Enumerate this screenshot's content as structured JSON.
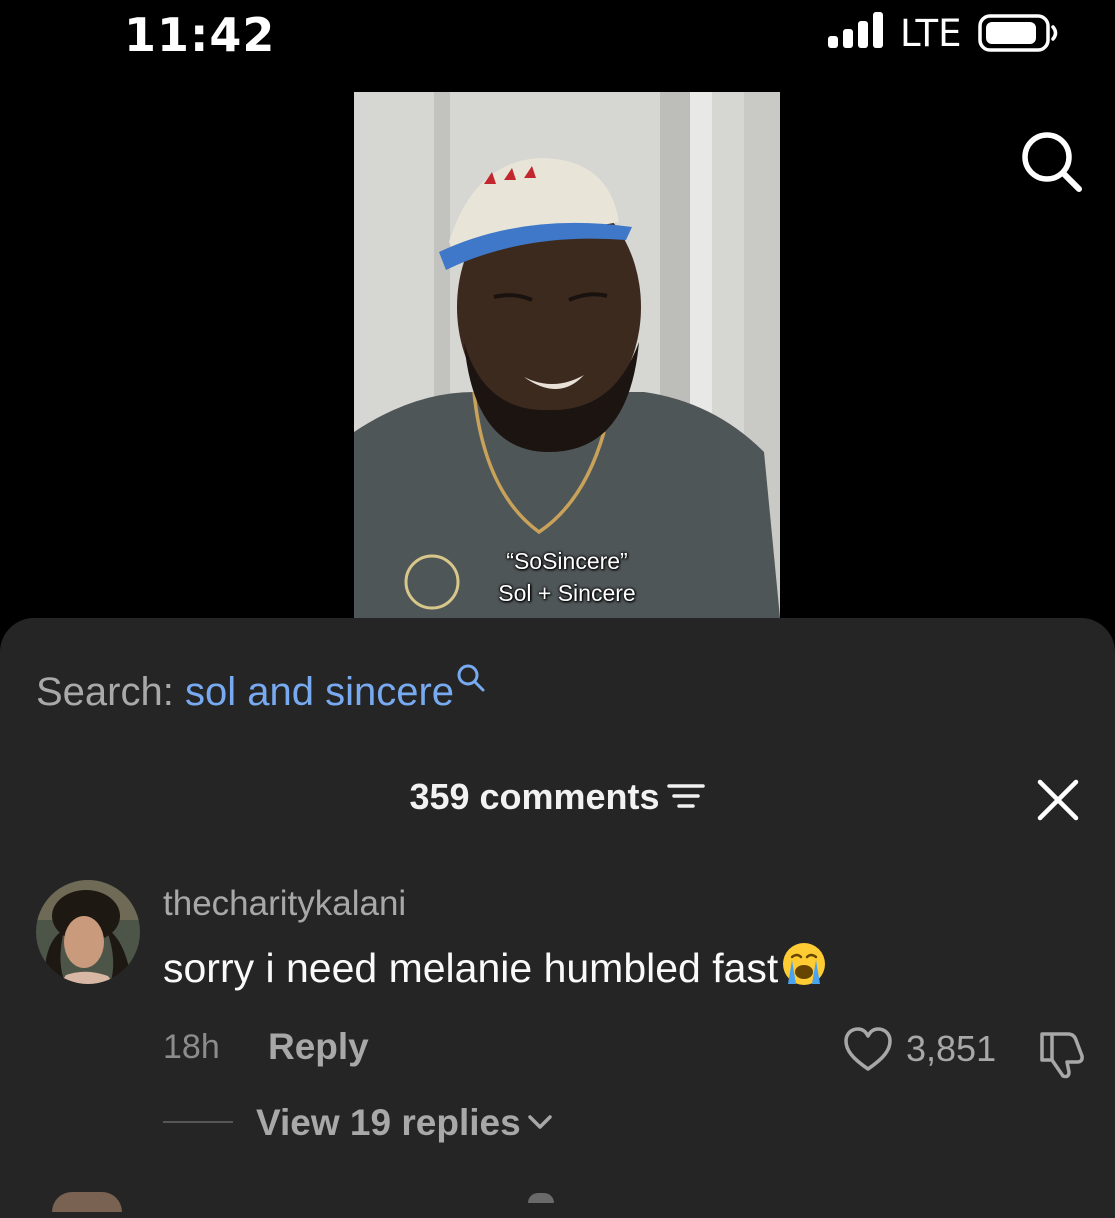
{
  "status_bar": {
    "time": "11:42",
    "network": "LTE",
    "signal_bars": 4,
    "battery_level": 0.85
  },
  "video": {
    "caption_lines": [
      "“SoSincere”",
      "Sol + Sincere"
    ],
    "icons": {
      "top_search": "search-icon"
    }
  },
  "search_suggestion": {
    "prefix": "Search: ",
    "term": "sol and sincere",
    "icon": "search-icon"
  },
  "comments": {
    "count_label": "359 comments",
    "sort_icon": "sort-lines-icon",
    "close_icon": "close-icon",
    "items": [
      {
        "username": "thecharitykalani",
        "text": "sorry i need melanie humbled fast",
        "emoji": "loudly-crying-face",
        "time": "18h",
        "reply_label": "Reply",
        "likes": "3,851",
        "view_replies_label": "View 19 replies"
      }
    ]
  },
  "colors": {
    "background": "#000000",
    "sheet": "#252525",
    "link": "#77aaf0",
    "secondary_text": "#a8a8a8"
  }
}
